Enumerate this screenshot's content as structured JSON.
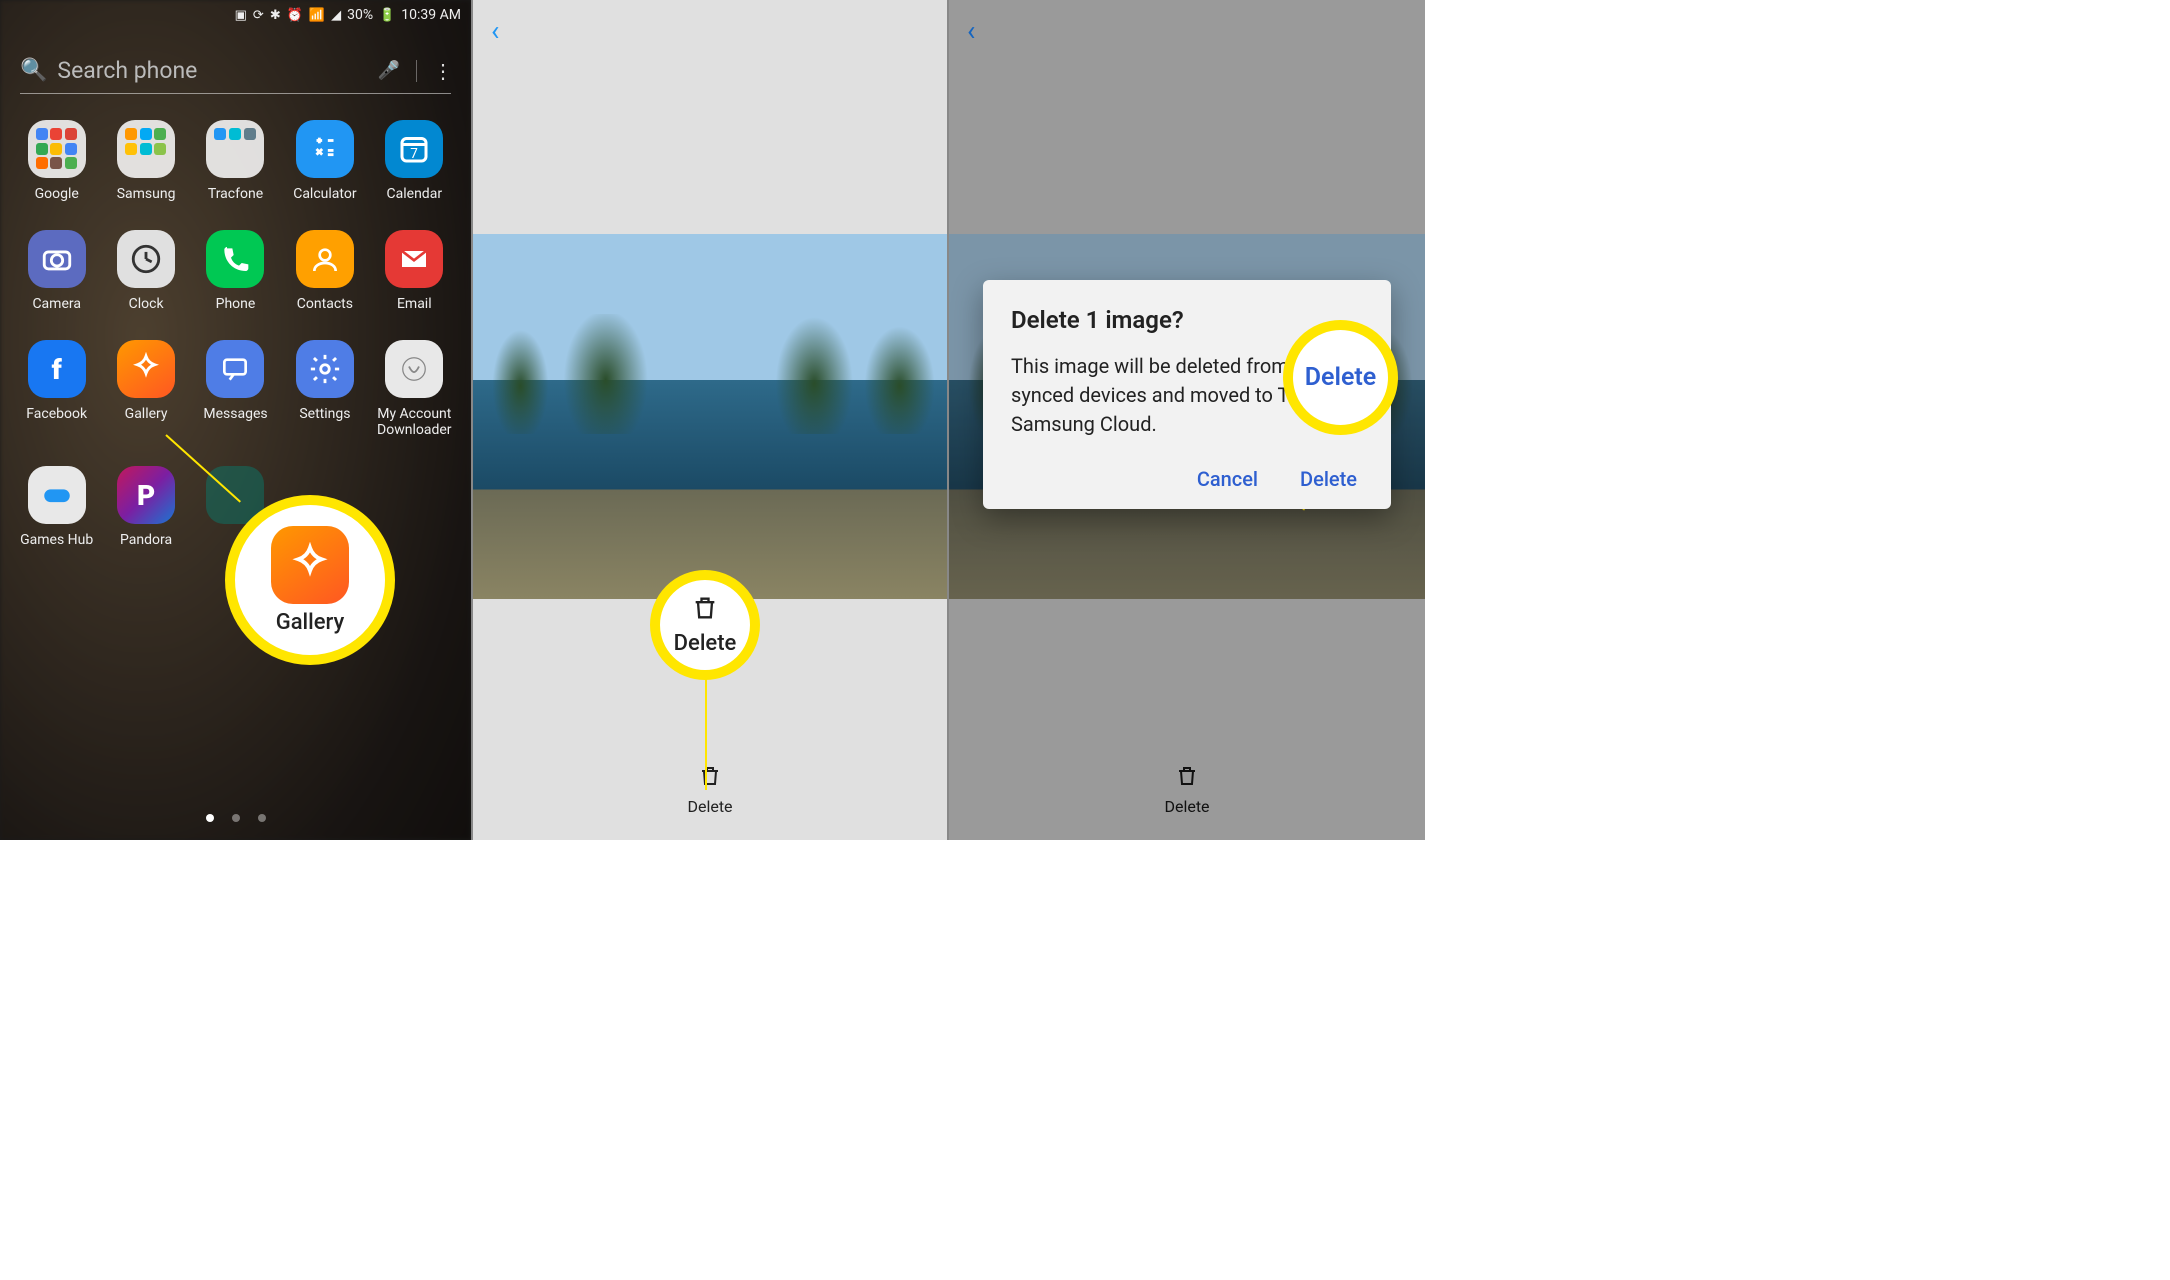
{
  "status": {
    "battery_pct": "30%",
    "time": "10:39 AM"
  },
  "search": {
    "placeholder": "Search phone"
  },
  "apps": {
    "google": "Google",
    "samsung": "Samsung",
    "tracfone": "Tracfone",
    "calculator": "Calculator",
    "calendar": "Calendar",
    "camera": "Camera",
    "clock": "Clock",
    "phone": "Phone",
    "contacts": "Contacts",
    "email": "Email",
    "facebook": "Facebook",
    "gallery": "Gallery",
    "messages": "Messages",
    "settings": "Settings",
    "myacct": "My Account Downloader",
    "games": "Games Hub",
    "pandora": "Pandora"
  },
  "highlight": {
    "gallery_label": "Gallery",
    "delete_btn_label": "Delete",
    "delete_confirm_label": "Delete"
  },
  "gallery_bar": {
    "delete": "Delete"
  },
  "dialog": {
    "title": "Delete 1 image?",
    "body": "This image will be deleted from your synced devices and moved to Trash in Samsung Cloud.",
    "cancel": "Cancel",
    "delete": "Delete"
  }
}
